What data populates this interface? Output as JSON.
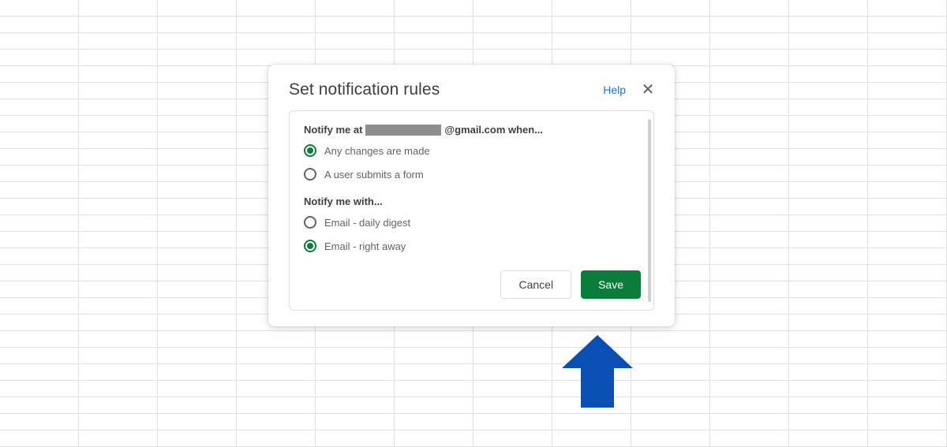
{
  "modal": {
    "title": "Set notification rules",
    "help_label": "Help",
    "close_label": "✕",
    "section1": {
      "prefix": "Notify me at",
      "email_suffix": "@gmail.com when...",
      "options": [
        {
          "label": "Any changes are made",
          "selected": true
        },
        {
          "label": "A user submits a form",
          "selected": false
        }
      ]
    },
    "section2": {
      "title": "Notify me with...",
      "options": [
        {
          "label": "Email - daily digest",
          "selected": false
        },
        {
          "label": "Email - right away",
          "selected": true
        }
      ]
    },
    "buttons": {
      "cancel": "Cancel",
      "save": "Save"
    }
  }
}
